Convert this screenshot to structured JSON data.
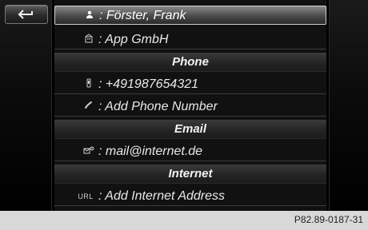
{
  "toolbar": {
    "back_button_icon": "back-arrow-icon",
    "menu_button_icon": "list-menu-icon"
  },
  "contact": {
    "name": ": Förster, Frank",
    "name_icon": "person-icon",
    "company": ": App GmbH",
    "company_icon": "building-icon"
  },
  "sections": {
    "phone": {
      "title": "Phone",
      "number": ": +491987654321",
      "number_icon": "mobile-phone-icon",
      "add": ": Add Phone Number",
      "add_icon": "handset-icon"
    },
    "email": {
      "title": "Email",
      "address": ": mail@internet.de",
      "address_icon": "email-at-icon"
    },
    "internet": {
      "title": "Internet",
      "add": ": Add Internet Address",
      "url_badge": "URL",
      "url_icon": "url-icon"
    }
  },
  "footer": {
    "code": "P82.89-0187-31"
  },
  "colors": {
    "selected_row_bg": "#5e5e5e",
    "header_bg": "#2a2a2a",
    "screen_bg": "#000000",
    "footer_bg": "#d8d8d8"
  }
}
